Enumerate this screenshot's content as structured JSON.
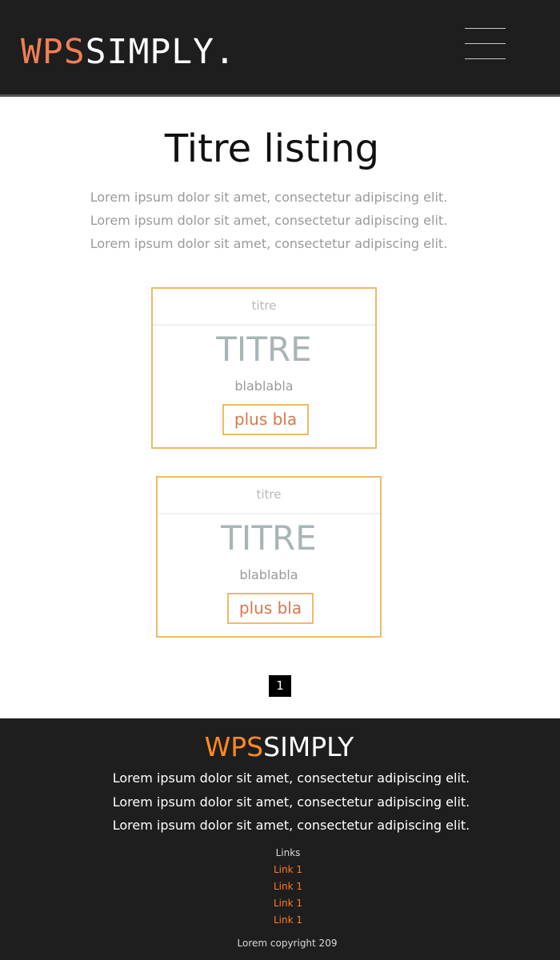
{
  "header": {
    "logo_accent": "WPS",
    "logo_rest": "SIMPLY.",
    "menu_icon": "hamburger-menu-icon"
  },
  "main": {
    "title": "Titre listing",
    "intro_lines": [
      "Lorem ipsum dolor sit amet, consectetur adipiscing elit.",
      "Lorem ipsum dolor sit amet, consectetur adipiscing elit.",
      "Lorem ipsum dolor sit amet, consectetur adipiscing elit."
    ],
    "cards": [
      {
        "header": "titre",
        "title": "TITRE",
        "text": "blablabla",
        "button_label": "plus bla"
      },
      {
        "header": "titre",
        "title": "TITRE",
        "text": "blablabla",
        "button_label": "plus bla"
      }
    ],
    "pagination": {
      "current_page": "1"
    }
  },
  "footer": {
    "logo_accent": "WPS",
    "logo_rest": "SIMPLY",
    "text_lines": [
      "Lorem ipsum dolor sit amet, consectetur adipiscing elit.",
      "Lorem ipsum dolor sit amet, consectetur adipiscing elit.",
      "Lorem ipsum dolor sit amet, consectetur adipiscing elit."
    ],
    "links_title": "Links",
    "links": [
      "Link 1",
      "Link 1",
      "Link 1",
      "Link 1"
    ],
    "copyright": "Lorem copyright 209"
  },
  "colors": {
    "header_bg": "#1e1e1e",
    "logo_accent": "#f07f55",
    "card_border": "#f0b96a",
    "button_text": "#d9754a",
    "footer_accent": "#ff8a1e",
    "link": "#ff7a1e"
  }
}
